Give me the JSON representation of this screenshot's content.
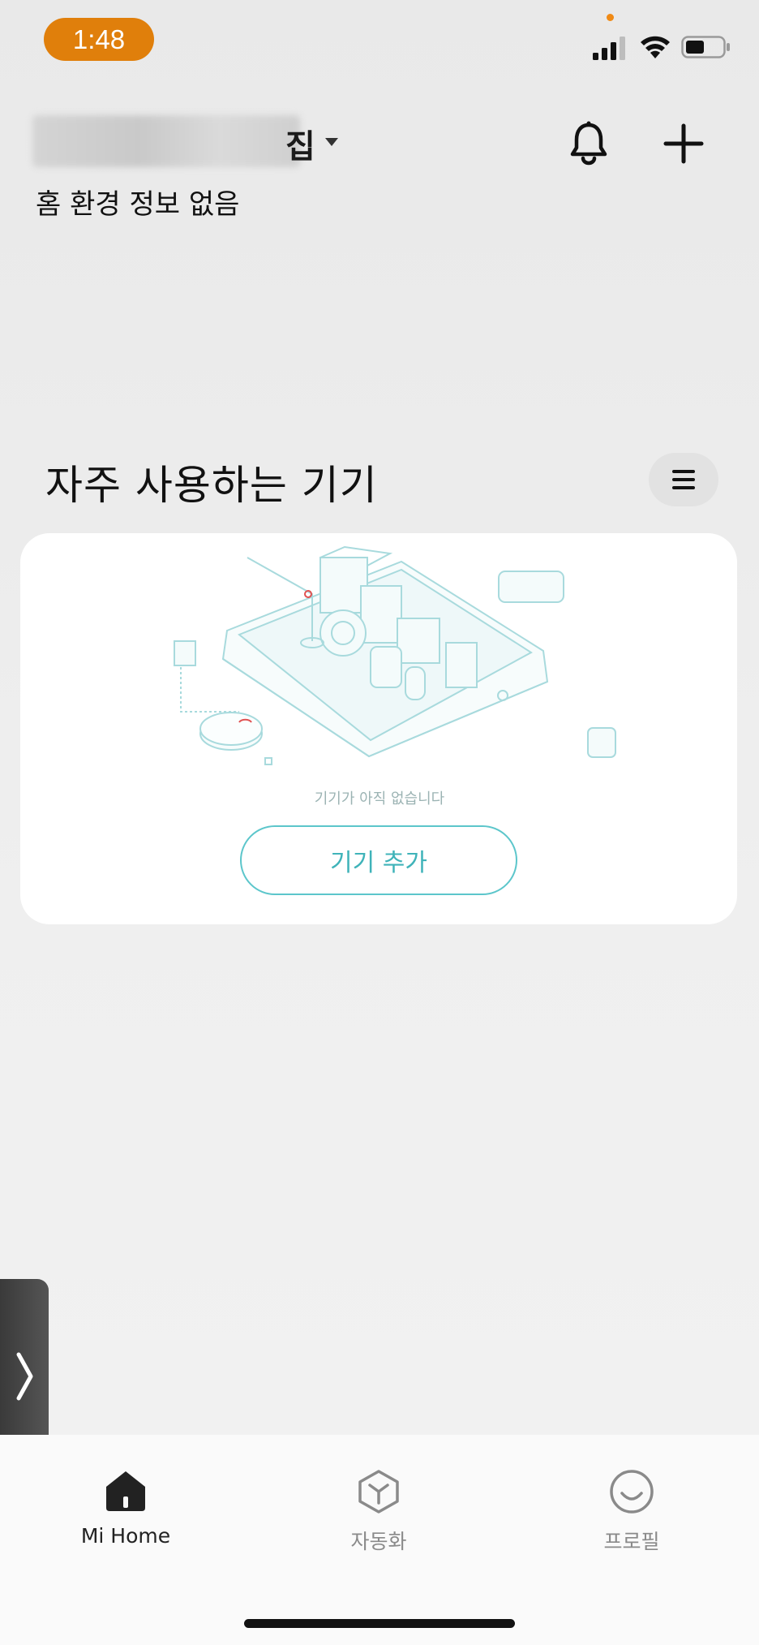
{
  "status_bar": {
    "time": "1:48"
  },
  "header": {
    "home_name_visible_suffix": "집",
    "home_env_text": "홈 환경 정보 없음"
  },
  "section": {
    "title": "자주 사용하는 기기"
  },
  "card": {
    "empty_text": "기기가 아직 없습니다",
    "add_button_label": "기기 추가"
  },
  "tabs": [
    {
      "label": "Mi Home",
      "icon": "home-icon",
      "active": true
    },
    {
      "label": "자동화",
      "icon": "cube-icon",
      "active": false
    },
    {
      "label": "프로필",
      "icon": "smile-icon",
      "active": false
    }
  ],
  "colors": {
    "time_pill": "#e07f0b",
    "accent": "#3fb3b9",
    "active_tab": "#222222",
    "inactive_tab": "#8a8a8a"
  }
}
